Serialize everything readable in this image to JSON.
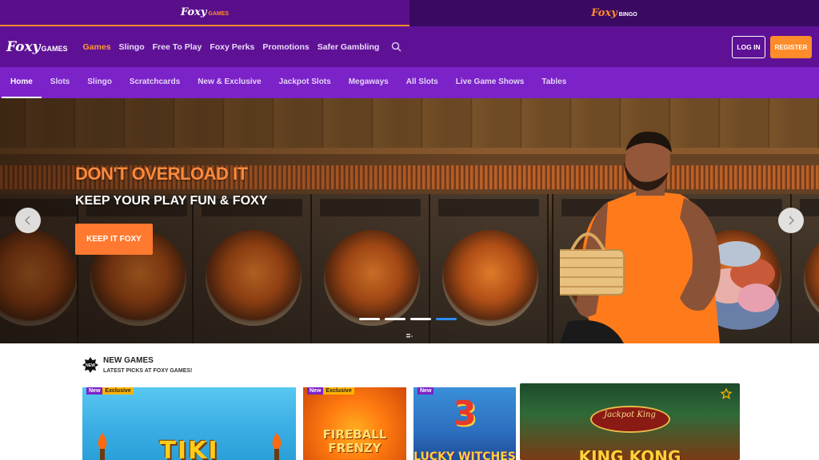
{
  "brands": {
    "games": {
      "name": "Foxy",
      "sub": "GAMES"
    },
    "bingo": {
      "name": "Foxy",
      "sub": "BINGO"
    }
  },
  "header": {
    "logo": {
      "name": "Foxy",
      "sub": "GAMES"
    },
    "nav": [
      "Games",
      "Slingo",
      "Free To Play",
      "Foxy Perks",
      "Promotions",
      "Safer Gambling"
    ],
    "active_nav": "Games",
    "login_label": "LOG IN",
    "register_label": "REGISTER"
  },
  "subnav": {
    "items": [
      "Home",
      "Slots",
      "Slingo",
      "Scratchcards",
      "New & Exclusive",
      "Jackpot Slots",
      "Megaways",
      "All Slots",
      "Live Game Shows",
      "Tables"
    ],
    "active": "Home"
  },
  "hero": {
    "title": "DON'T OVERLOAD IT",
    "subtitle": "KEEP YOUR PLAY FUN & FOXY",
    "cta": "KEEP IT FOXY",
    "slide_count": 4,
    "active_slide": 4
  },
  "new_games": {
    "badge": "NEW",
    "title": "NEW GAMES",
    "subtitle": "LATEST PICKS AT FOXY GAMES!",
    "tiles": [
      {
        "name": "TIKI",
        "tags": [
          "New",
          "Exclusive"
        ]
      },
      {
        "name": "FIREBALL FRENZY",
        "tags": [
          "New",
          "Exclusive"
        ]
      },
      {
        "name": "LUCKY WITCHES",
        "number": "3",
        "tags": [
          "New"
        ]
      },
      {
        "name": "KING KONG",
        "badge": "Jackpot King",
        "tags": []
      }
    ]
  },
  "colors": {
    "brand_purple": "#5f1196",
    "subnav_purple": "#7b22c8",
    "accent_orange": "#ff8c2a"
  }
}
